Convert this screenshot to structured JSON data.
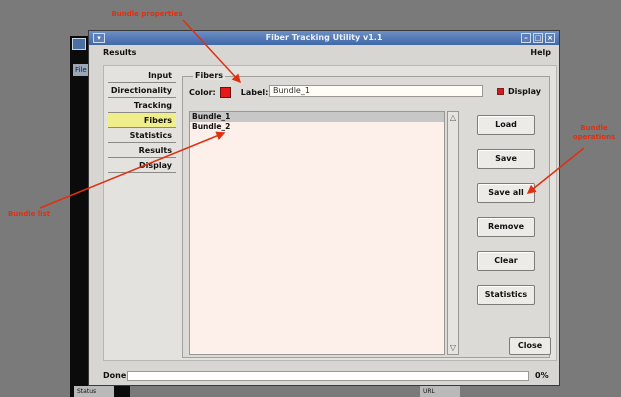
{
  "window": {
    "title": "Fiber Tracking Utility v1.1",
    "menu_results": "Results",
    "menu_help": "Help"
  },
  "background": {
    "tab_label": "File",
    "status_left": "Status",
    "status_right": "URL"
  },
  "sidebar": {
    "items": [
      {
        "label": "Input"
      },
      {
        "label": "Directionality"
      },
      {
        "label": "Tracking"
      },
      {
        "label": "Fibers",
        "active": true
      },
      {
        "label": "Statistics"
      },
      {
        "label": "Results"
      },
      {
        "label": "Display"
      }
    ]
  },
  "fibers": {
    "group_title": "Fibers",
    "color_label": "Color:",
    "color_value": "#e81818",
    "label_label": "Label:",
    "label_value": "Bundle_1",
    "display_label": "Display",
    "display_checked": true,
    "bundles": [
      "Bundle_1",
      "Bundle_2"
    ],
    "selected_index": 0
  },
  "buttons": {
    "load": "Load",
    "save": "Save",
    "save_all": "Save all",
    "remove": "Remove",
    "clear": "Clear",
    "statistics": "Statistics",
    "close": "Close"
  },
  "status": {
    "text": "Done",
    "progress_percent_label": "0%",
    "progress": 0
  },
  "annotations": {
    "top": "Bundle properties",
    "left": "Bundle list",
    "right": "Bundle operations"
  },
  "colors": {
    "accent": "#3f68a8",
    "annotation": "#e03010",
    "active_tab": "#f0ee8a"
  }
}
